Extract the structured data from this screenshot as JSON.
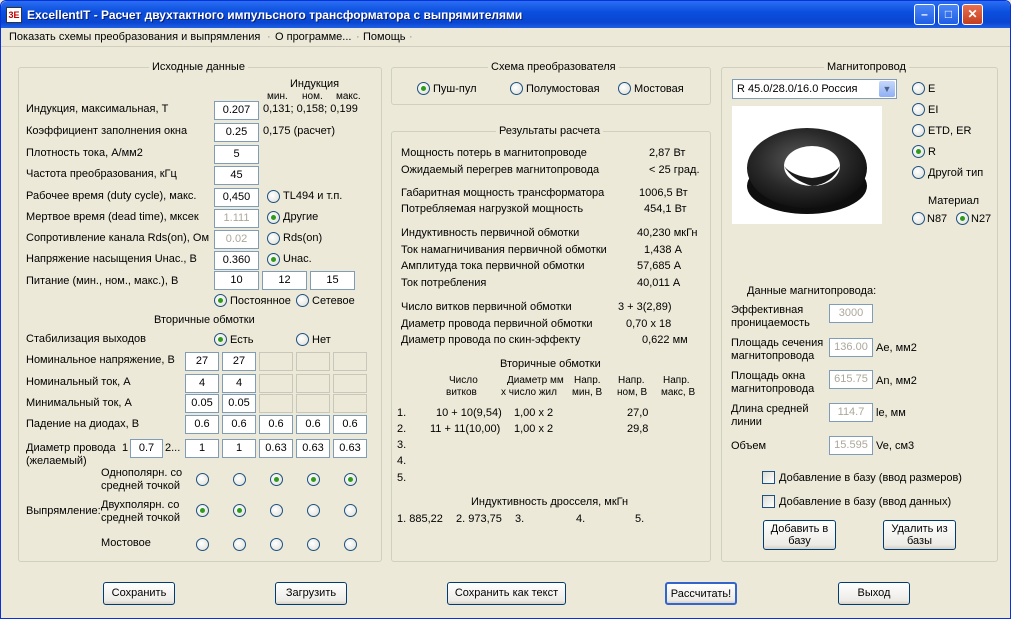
{
  "window": {
    "title": "ExcellentIT - Расчет двухтактного импульсного трансформатора с выпрямителями",
    "icon_text": "3E"
  },
  "menu": [
    "Показать схемы преобразования и выпрямления",
    "О программе...",
    "Помощь"
  ],
  "input": {
    "title": "Исходные данные",
    "induction_header": "Индукция",
    "induction_cols": [
      "мин.",
      "ном.",
      "макс."
    ],
    "rows": [
      {
        "label": "Индукция, максимальная, Т",
        "value": "0.207",
        "note": "0,131; 0,158; 0,199"
      },
      {
        "label": "Коэффициент заполнения окна",
        "value": "0.25",
        "note": "0,175 (расчет)"
      },
      {
        "label": "Плотность тока, А/мм2",
        "value": "5",
        "note": ""
      },
      {
        "label": "Частота преобразования, кГц",
        "value": "45",
        "note": ""
      },
      {
        "label": "Рабочее время (duty cycle), макс.",
        "value": "0,450",
        "note": ""
      },
      {
        "label": "Мертвое время (dead time), мксек",
        "value": "1.111",
        "note": ""
      },
      {
        "label": "Сопротивление канала Rds(on), Ом",
        "value": "0.02",
        "note": ""
      },
      {
        "label": "Напряжение насыщения Uнас., В",
        "value": "0.360",
        "note": ""
      }
    ],
    "ctrl_options": [
      {
        "label": "TL494 и т.п.",
        "checked": false
      },
      {
        "label": "Другие",
        "checked": true
      },
      {
        "label": "Rds(on)",
        "checked": false
      },
      {
        "label": "Uнас.",
        "checked": true
      }
    ],
    "supply_label": "Питание (мин., ном., макс.), В",
    "supply": [
      "10",
      "12",
      "15"
    ],
    "supply_type": [
      {
        "label": "Постоянное",
        "checked": true
      },
      {
        "label": "Сетевое",
        "checked": false
      }
    ]
  },
  "secondary": {
    "title": "Вторичные обмотки",
    "stab_label": "Стабилизация выходов",
    "stab": [
      {
        "label": "Есть",
        "checked": true
      },
      {
        "label": "Нет",
        "checked": false
      }
    ],
    "rows": [
      {
        "label": "Номинальное напряжение, В",
        "values": [
          "27",
          "27",
          "",
          "",
          ""
        ]
      },
      {
        "label": "Номинальный ток, А",
        "values": [
          "4",
          "4",
          "",
          "",
          ""
        ]
      },
      {
        "label": "Минимальный ток, А",
        "values": [
          "0.05",
          "0.05",
          "",
          "",
          ""
        ]
      },
      {
        "label": "Падение на диодах, В",
        "values": [
          "0.6",
          "0.6",
          "0.6",
          "0.6",
          "0.6"
        ]
      }
    ],
    "wire_label": "Диаметр провода\n(желаемый)",
    "wire_label1": "Диаметр провода",
    "wire_label2": "(желаемый)",
    "wire_n1": "1",
    "wire_n2": "2...",
    "wire_values": [
      "0.7",
      "1",
      "1",
      "0.63",
      "0.63",
      "0.63"
    ],
    "rect_label": "Выпрямление:",
    "rect_types": [
      {
        "label1": "Однополярн. со",
        "label2": "средней точкой",
        "checked": [
          false,
          false,
          true,
          true,
          true
        ]
      },
      {
        "label1": "Двухполярн. со",
        "label2": "средней точкой",
        "checked": [
          true,
          true,
          false,
          false,
          false
        ]
      },
      {
        "label1": "Мостовое",
        "label2": "",
        "checked": [
          false,
          false,
          false,
          false,
          false
        ]
      }
    ]
  },
  "scheme": {
    "title": "Схема преобразователя",
    "options": [
      {
        "label": "Пуш-пул",
        "checked": true
      },
      {
        "label": "Полумостовая",
        "checked": false
      },
      {
        "label": "Мостовая",
        "checked": false
      }
    ]
  },
  "results": {
    "title": "Результаты расчета",
    "lines": [
      {
        "label": "Мощность потерь в магнитопроводе",
        "value": "2,87 Вт"
      },
      {
        "label": "Ожидаемый перегрев магнитопровода",
        "value": "< 25 град."
      },
      {
        "label": "Габаритная мощность трансформатора",
        "value": "1006,5 Вт"
      },
      {
        "label": "Потребляемая нагрузкой мощность",
        "value": "454,1 Вт"
      },
      {
        "label": "Индуктивность первичной обмотки",
        "value": "40,230 мкГн"
      },
      {
        "label": "Ток намагничивания первичной обмотки",
        "value": "1,438 А"
      },
      {
        "label": "Амплитуда тока первичной обмотки",
        "value": "57,685 А"
      },
      {
        "label": "Ток потребления",
        "value": "40,011 А"
      },
      {
        "label": "Число витков первичной обмотки",
        "value": "3 + 3(2,89)"
      },
      {
        "label": "Диаметр провода первичной обмотки",
        "value": "0,70 х 18"
      },
      {
        "label": "Диаметр провода по скин-эффекту",
        "value": "0,622 мм"
      }
    ],
    "sec_title": "Вторичные обмотки",
    "sec_headers": [
      [
        "Число",
        "витков"
      ],
      [
        "Диаметр мм",
        "х число жил"
      ],
      [
        "Напр.",
        "мин, В"
      ],
      [
        "Напр.",
        "ном, В"
      ],
      [
        "Напр.",
        "макс, В"
      ]
    ],
    "sec_rows": [
      {
        "n": "1.",
        "turns": "10 + 10(9,54)",
        "diam": "1,00 x 2",
        "vmin": "",
        "vnom": "27,0",
        "vmax": ""
      },
      {
        "n": "2.",
        "turns": "11 + 11(10,00)",
        "diam": "1,00 x 2",
        "vmin": "",
        "vnom": "29,8",
        "vmax": ""
      },
      {
        "n": "3.",
        "turns": "",
        "diam": "",
        "vmin": "",
        "vnom": "",
        "vmax": ""
      },
      {
        "n": "4.",
        "turns": "",
        "diam": "",
        "vmin": "",
        "vnom": "",
        "vmax": ""
      },
      {
        "n": "5.",
        "turns": "",
        "diam": "",
        "vmin": "",
        "vnom": "",
        "vmax": ""
      }
    ],
    "choke_title": "Индуктивность дросселя, мкГн",
    "choke": [
      "1. 885,22",
      "2. 973,75",
      "3.",
      "4.",
      "5."
    ]
  },
  "core": {
    "title": "Магнитопровод",
    "selected": "R 45.0/28.0/16.0 Россия",
    "types": [
      {
        "label": "E",
        "checked": false
      },
      {
        "label": "EI",
        "checked": false
      },
      {
        "label": "ETD, ER",
        "checked": false
      },
      {
        "label": "R",
        "checked": true
      },
      {
        "label": "Другой тип",
        "checked": false
      }
    ],
    "material_title": "Материал",
    "materials": [
      {
        "label": "N87",
        "checked": false
      },
      {
        "label": "N27",
        "checked": true
      }
    ],
    "data_title": "Данные магнитопровода:",
    "params": [
      {
        "l1": "Эффективная",
        "l2": "проницаемость",
        "value": "3000",
        "unit": ""
      },
      {
        "l1": "Площадь сечения",
        "l2": "магнитопровода",
        "value": "136.00",
        "unit": "Ae, мм2"
      },
      {
        "l1": "Площадь окна",
        "l2": "магнитопровода",
        "value": "615.75",
        "unit": "An, мм2"
      },
      {
        "l1": "Длина средней",
        "l2": "линии",
        "value": "114.7",
        "unit": "le, мм"
      },
      {
        "l1": "Объем",
        "l2": "",
        "value": "15.595",
        "unit": "Ve, см3"
      }
    ],
    "db_checks": [
      "Добавление в базу (ввод размеров)",
      "Добавление в базу (ввод данных)"
    ],
    "add_btn": "Добавить в базу",
    "del_btn": "Удалить из базы"
  },
  "buttons": [
    "Сохранить",
    "Загрузить",
    "Сохранить как текст",
    "Рассчитать!",
    "Выход"
  ]
}
